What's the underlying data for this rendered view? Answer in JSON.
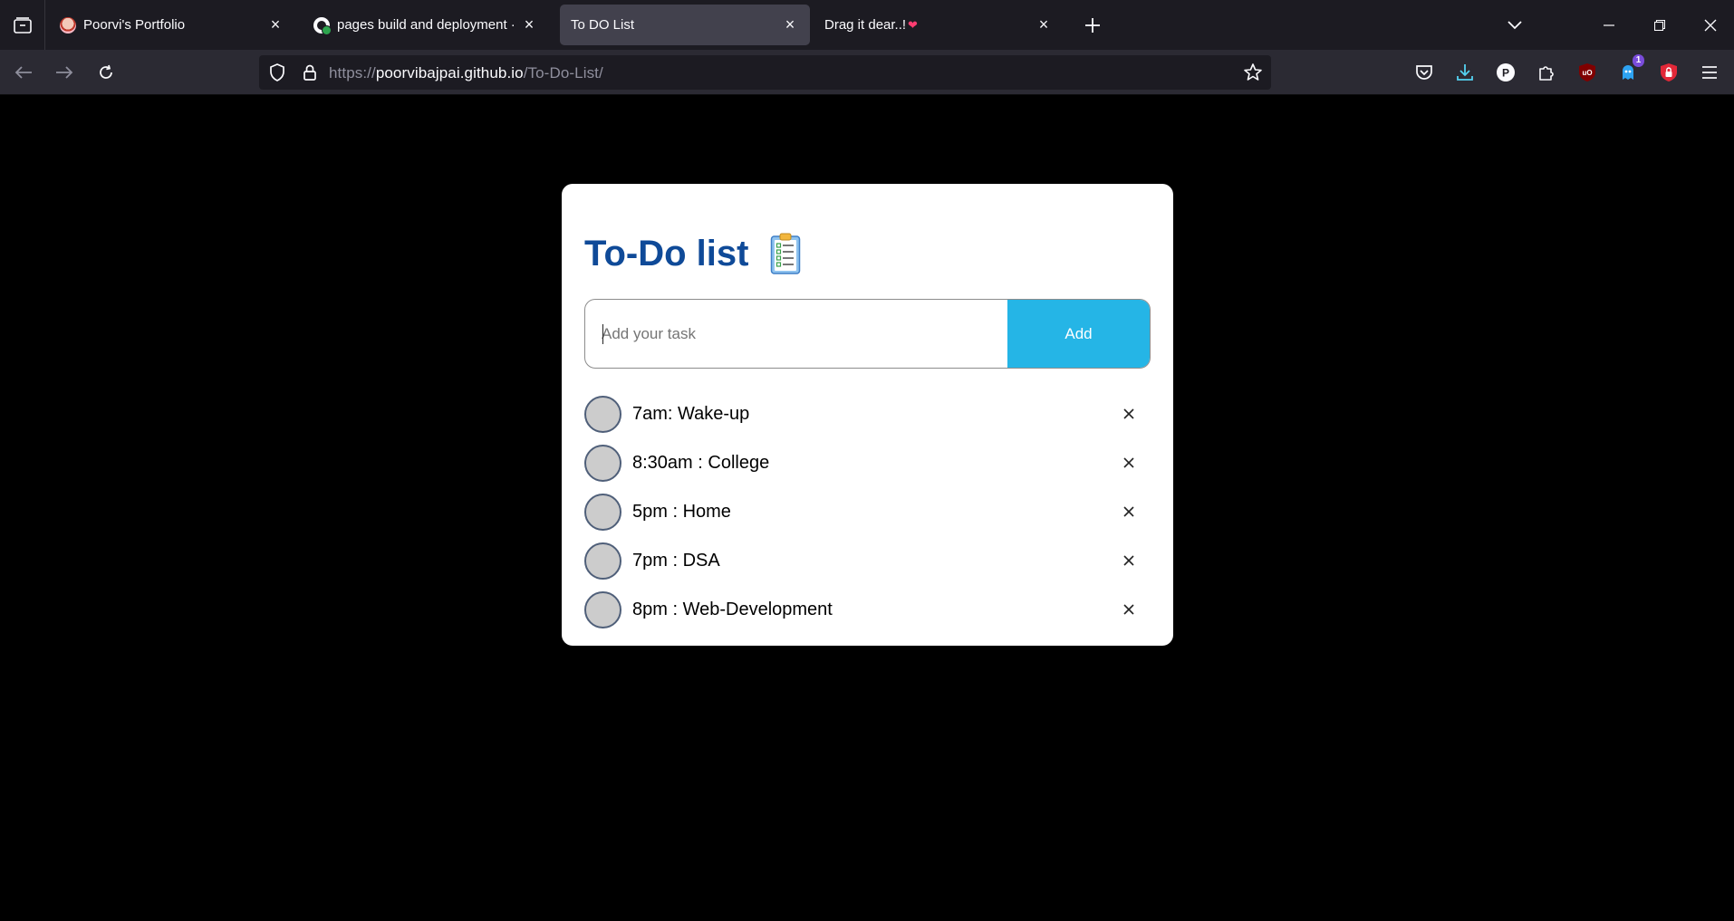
{
  "browser": {
    "tabs": [
      {
        "title": "Poorvi's Portfolio",
        "favicon": "portfolio-avatar-icon",
        "active": false
      },
      {
        "title": "pages build and deployment · p",
        "favicon": "github-icon",
        "active": false
      },
      {
        "title": "To DO List",
        "favicon": "",
        "active": true
      },
      {
        "title": "Drag it dear..!",
        "favicon": "",
        "suffix": "❤",
        "active": false
      }
    ],
    "url": {
      "scheme": "https://",
      "host": "poorvibajpai.github.io",
      "path": "/To-Do-List/"
    },
    "extensions": [
      {
        "name": "pocket-icon"
      },
      {
        "name": "downloads-icon",
        "color": "#54d1f0"
      },
      {
        "name": "profile-p-icon",
        "label": "P"
      },
      {
        "name": "extensions-puzzle-icon"
      },
      {
        "name": "ublock-icon",
        "label": "uO"
      },
      {
        "name": "extension-badge-icon",
        "badge": "1"
      },
      {
        "name": "lock-extension-icon"
      },
      {
        "name": "menu-icon"
      }
    ]
  },
  "app": {
    "title": "To-Do list",
    "input": {
      "placeholder": "Add your task",
      "value": ""
    },
    "add_label": "Add",
    "tasks": [
      {
        "text": "7am: Wake-up"
      },
      {
        "text": "8:30am : College"
      },
      {
        "text": "5pm : Home"
      },
      {
        "text": "7pm : DSA"
      },
      {
        "text": "8pm : Web-Development"
      }
    ],
    "colors": {
      "title": "#0f4a98",
      "add_button": "#25b5e6",
      "background": "#000000",
      "card": "#ffffff"
    }
  }
}
